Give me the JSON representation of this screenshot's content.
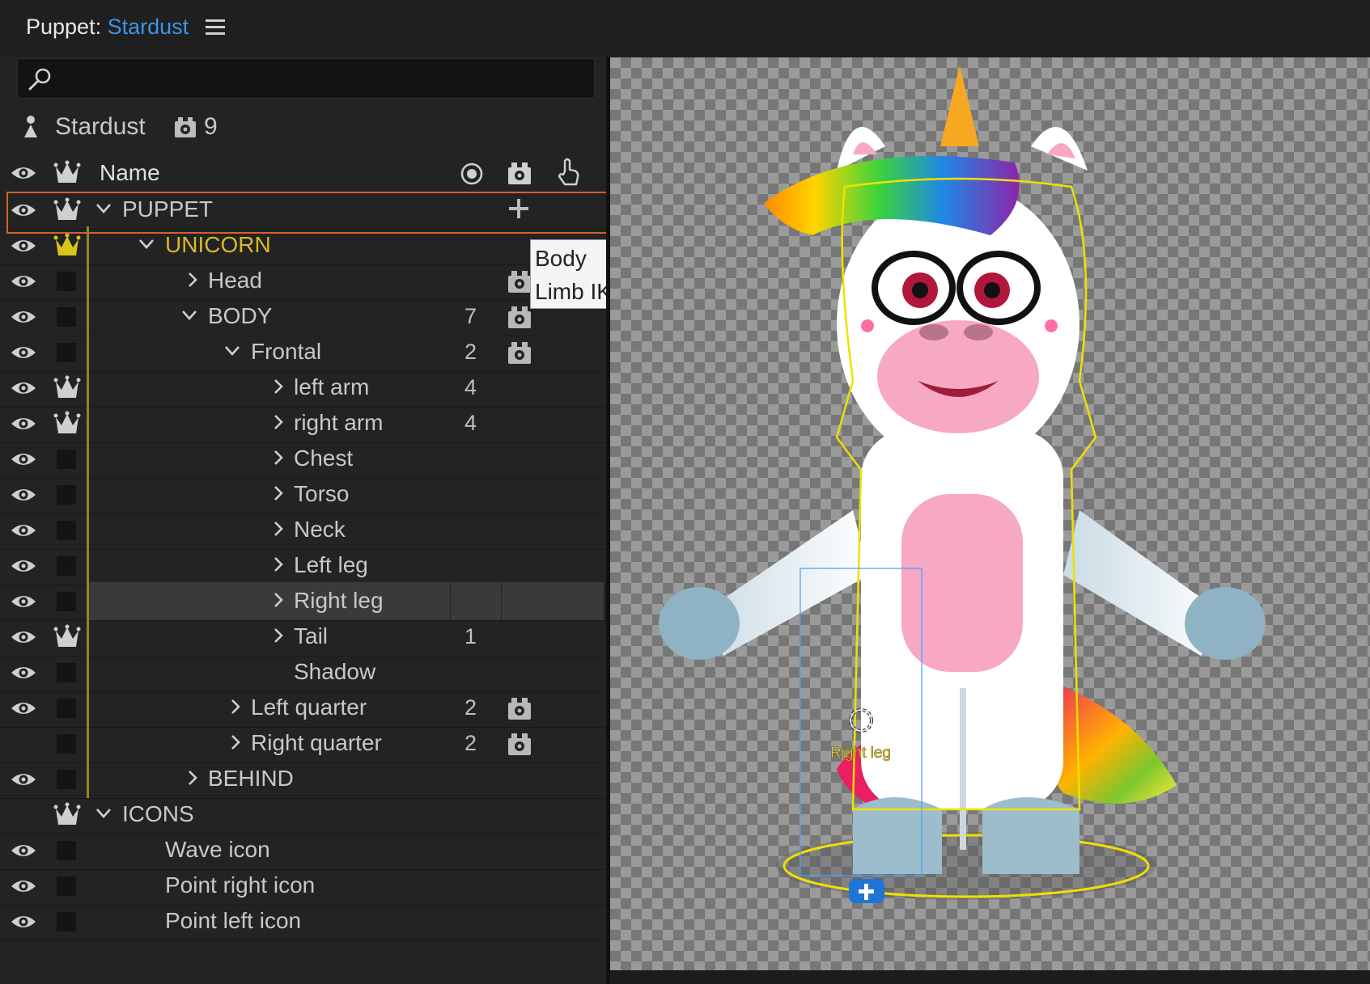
{
  "window": {
    "title_prefix": "Puppet:",
    "puppet_name": "Stardust",
    "menu_icon": "hamburger-menu-icon"
  },
  "search": {
    "placeholder": "",
    "icon": "search-icon"
  },
  "summary": {
    "name": "Stardust",
    "count": "9"
  },
  "header": {
    "name_label": "Name",
    "icons": [
      "eye-icon",
      "crown-icon",
      "handle-target-icon",
      "rig-icon",
      "hand-icon"
    ]
  },
  "colors": {
    "accent_blue": "#3d94e6",
    "selection_outline": "#d2612c",
    "crown_yellow": "#d9c41c",
    "unicorn_label": "#d9b928",
    "guide_line": "#8f8a1e"
  },
  "rows": [
    {
      "label": "PUPPET",
      "expanded": true,
      "has_chevron": true,
      "eye": true,
      "crown": true,
      "count": "",
      "gear": false,
      "plus": true
    },
    {
      "label": "UNICORN",
      "expanded": true,
      "has_chevron": true,
      "eye": true,
      "crown": true,
      "crown_active": true,
      "count": "",
      "gear": false
    },
    {
      "label": "Head",
      "expanded": false,
      "has_chevron": true,
      "eye": true,
      "crown": false,
      "count": "",
      "gear": true
    },
    {
      "label": "BODY",
      "expanded": true,
      "has_chevron": true,
      "eye": true,
      "crown": false,
      "count": "7",
      "gear": true
    },
    {
      "label": "Frontal",
      "expanded": true,
      "has_chevron": true,
      "eye": true,
      "crown": false,
      "count": "2",
      "gear": true
    },
    {
      "label": "left arm",
      "expanded": false,
      "has_chevron": true,
      "eye": true,
      "crown": true,
      "count": "4",
      "gear": false
    },
    {
      "label": "right arm",
      "expanded": false,
      "has_chevron": true,
      "eye": true,
      "crown": true,
      "count": "4",
      "gear": false
    },
    {
      "label": "Chest",
      "expanded": false,
      "has_chevron": true,
      "eye": true,
      "crown": false,
      "count": "",
      "gear": false
    },
    {
      "label": "Torso",
      "expanded": false,
      "has_chevron": true,
      "eye": true,
      "crown": false,
      "count": "",
      "gear": false
    },
    {
      "label": "Neck",
      "expanded": false,
      "has_chevron": true,
      "eye": true,
      "crown": false,
      "count": "",
      "gear": false
    },
    {
      "label": "Left leg",
      "expanded": false,
      "has_chevron": true,
      "eye": true,
      "crown": false,
      "count": "",
      "gear": false
    },
    {
      "label": "Right leg",
      "expanded": false,
      "has_chevron": true,
      "eye": true,
      "crown": false,
      "count": "",
      "gear": false,
      "selected": true
    },
    {
      "label": "Tail",
      "expanded": false,
      "has_chevron": true,
      "eye": true,
      "crown": true,
      "count": "1",
      "gear": false
    },
    {
      "label": "Shadow",
      "expanded": false,
      "has_chevron": false,
      "eye": true,
      "crown": false,
      "count": "",
      "gear": false
    },
    {
      "label": "Left quarter",
      "expanded": false,
      "has_chevron": true,
      "eye": true,
      "crown": false,
      "count": "2",
      "gear": true
    },
    {
      "label": "Right quarter",
      "expanded": false,
      "has_chevron": true,
      "eye": false,
      "crown": false,
      "count": "2",
      "gear": true
    },
    {
      "label": "BEHIND",
      "expanded": false,
      "has_chevron": true,
      "eye": true,
      "crown": false,
      "count": "",
      "gear": false
    },
    {
      "label": "ICONS",
      "expanded": true,
      "has_chevron": true,
      "eye": false,
      "crown": true,
      "count": "",
      "gear": false
    },
    {
      "label": "Wave icon",
      "expanded": false,
      "has_chevron": false,
      "eye": true,
      "crown": false,
      "count": "",
      "gear": false
    },
    {
      "label": "Point right icon",
      "expanded": false,
      "has_chevron": false,
      "eye": true,
      "crown": false,
      "count": "",
      "gear": false
    },
    {
      "label": "Point left icon",
      "expanded": false,
      "has_chevron": false,
      "eye": true,
      "crown": false,
      "count": "",
      "gear": false
    }
  ],
  "tooltip": {
    "line1": "Body",
    "line2": "Limb IK"
  },
  "canvas": {
    "selected_layer_label": "Right leg",
    "icons": [
      "unicorn-puppet-illustration",
      "handle-origin-icon",
      "add-handle-icon"
    ]
  }
}
